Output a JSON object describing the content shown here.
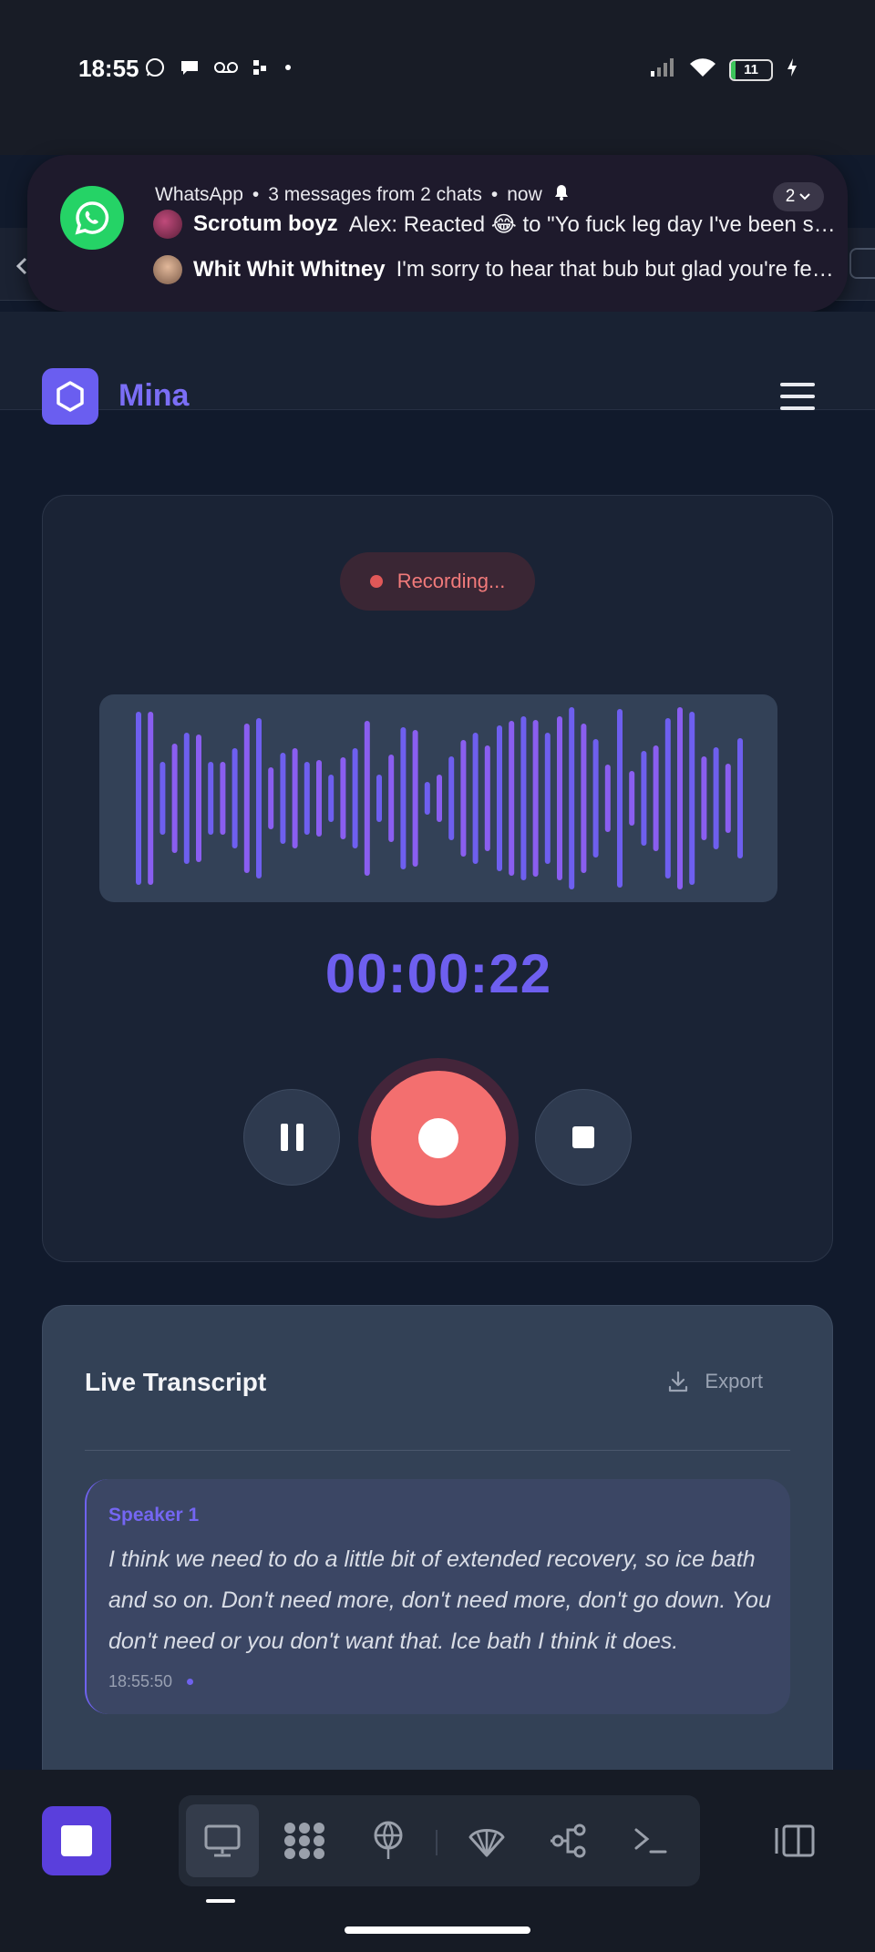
{
  "status_bar": {
    "time": "18:55",
    "battery": "11",
    "battery_level_percent": 11
  },
  "notification": {
    "app": "WhatsApp",
    "summary": "3 messages from 2 chats",
    "when": "now",
    "count": "2",
    "messages": [
      {
        "sender": "Scrotum boyz",
        "text": "Alex: Reacted 😂 to \"Yo fuck leg day I've been sore for days\""
      },
      {
        "sender": "Whit Whit Whitney",
        "text": "I'm sorry to hear that bub but glad you're feeling better"
      }
    ]
  },
  "header": {
    "brand": "Mina"
  },
  "recorder": {
    "status": "Recording...",
    "timer": "00:00:22",
    "waveform": [
      0.95,
      0.95,
      0.4,
      0.6,
      0.72,
      0.7,
      0.4,
      0.4,
      0.55,
      0.82,
      0.88,
      0.34,
      0.5,
      0.55,
      0.4,
      0.42,
      0.26,
      0.45,
      0.55,
      0.85,
      0.26,
      0.48,
      0.78,
      0.75,
      0.18,
      0.26,
      0.46,
      0.64,
      0.72,
      0.58,
      0.8,
      0.85,
      0.9,
      0.86,
      0.72,
      0.9,
      1.0,
      0.82,
      0.65,
      0.37,
      0.98,
      0.3,
      0.52,
      0.58,
      0.88,
      1.0,
      0.95,
      0.46,
      0.56,
      0.38,
      0.66
    ],
    "colors": {
      "accent": "#6e5fef",
      "record": "#f36f6f"
    }
  },
  "transcript": {
    "title": "Live Transcript",
    "export_label": "Export",
    "segments": [
      {
        "speaker": "Speaker 1",
        "text": "I think we need to do a little bit of extended recovery, so ice bath and so on. Don't need more, don't need more, don't go down. You don't need or you don't want that. Ice bath I think it does.",
        "time": "18:55:50"
      }
    ]
  },
  "taskbar": {
    "tools": [
      "desktop-icon",
      "apps-grid-icon",
      "network-icon",
      "shell-icon",
      "flow-icon",
      "terminal-icon"
    ],
    "active_tool": "desktop-icon"
  }
}
